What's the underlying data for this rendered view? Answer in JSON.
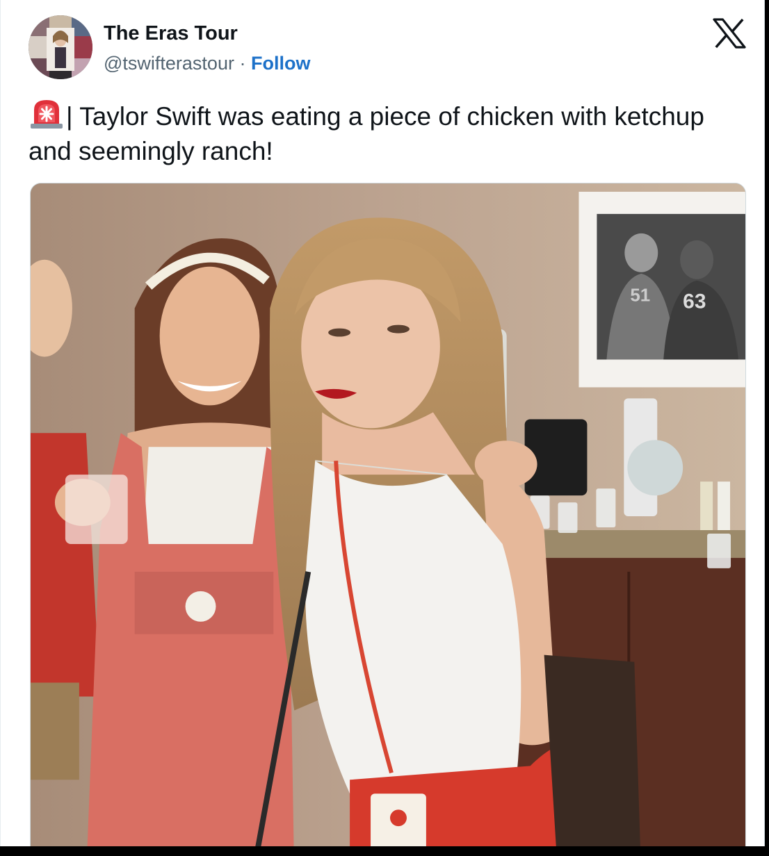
{
  "tweet": {
    "author_name": "The Eras Tour",
    "handle": "@tswifterastour",
    "separator": "·",
    "follow_label": "Follow",
    "text": "| Taylor Swift was eating a piece of chicken with ketchup and seemingly ranch!",
    "emoji_icon": "rotating-light-icon"
  },
  "icons": {
    "brand": "x-logo-icon"
  },
  "colors": {
    "follow": "#1d71c9",
    "text": "#0f1419",
    "secondary": "#536471",
    "siren": "#e0303a"
  },
  "media": {
    "photo_jersey_numbers": [
      "63",
      "51"
    ]
  }
}
